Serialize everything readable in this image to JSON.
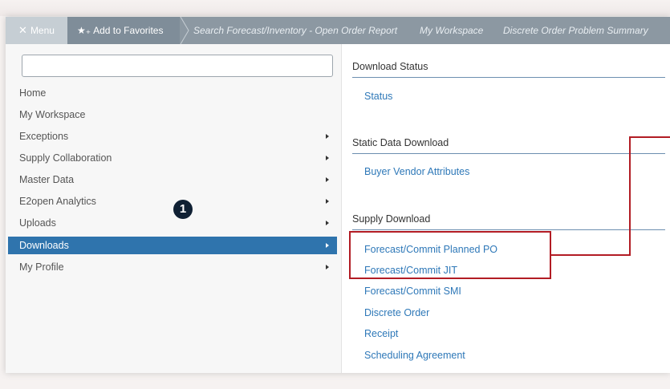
{
  "topbar": {
    "menu_label": "Menu",
    "favorites_label": "Add to Favorites",
    "breadcrumbs": [
      "Search Forecast/Inventory - Open Order Report",
      "My Workspace",
      "Discrete Order Problem Summary"
    ]
  },
  "sidebar": {
    "search_value": "",
    "items": [
      {
        "label": "Home",
        "has_submenu": false
      },
      {
        "label": "My Workspace",
        "has_submenu": false
      },
      {
        "label": "Exceptions",
        "has_submenu": true
      },
      {
        "label": "Supply Collaboration",
        "has_submenu": true
      },
      {
        "label": "Master Data",
        "has_submenu": true
      },
      {
        "label": "E2open Analytics",
        "has_submenu": true
      },
      {
        "label": "Uploads",
        "has_submenu": true
      },
      {
        "label": "Downloads",
        "has_submenu": true,
        "active": true
      },
      {
        "label": "My Profile",
        "has_submenu": true
      }
    ]
  },
  "callout": {
    "number": "1"
  },
  "panel": {
    "sections": [
      {
        "title": "Download Status",
        "links": [
          "Status"
        ]
      },
      {
        "title": "Static Data Download",
        "links": [
          "Buyer Vendor Attributes"
        ]
      },
      {
        "title": "Supply Download",
        "links": [
          "Forecast/Commit Planned PO",
          "Forecast/Commit JIT",
          "Forecast/Commit SMI",
          "Discrete Order",
          "Receipt",
          "Scheduling Agreement"
        ]
      }
    ]
  },
  "colors": {
    "topbar": "#8c98a2",
    "active_nav": "#2f74ad",
    "link": "#2e78b8",
    "highlight": "#b21c24",
    "callout_badge": "#0f2033"
  }
}
